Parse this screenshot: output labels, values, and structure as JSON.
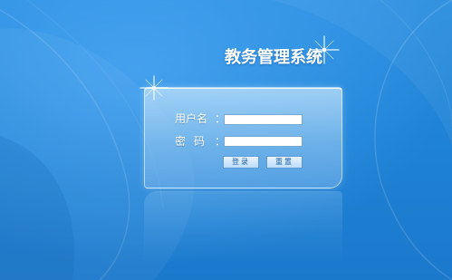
{
  "app": {
    "title": "教务管理系统"
  },
  "login_form": {
    "username_label": "用户名",
    "password_label": "密码",
    "colon": "：",
    "username_value": "",
    "password_value": "",
    "login_button": "登录",
    "reset_button": "重置"
  },
  "icons": {
    "title_sparkle": "sparkle-icon",
    "panel_sparkle": "sparkle-icon"
  },
  "colors": {
    "background": "#1f83d6",
    "panel": "#a9d3f6",
    "button_text": "#1f5fa8",
    "text": "#ffffff"
  }
}
